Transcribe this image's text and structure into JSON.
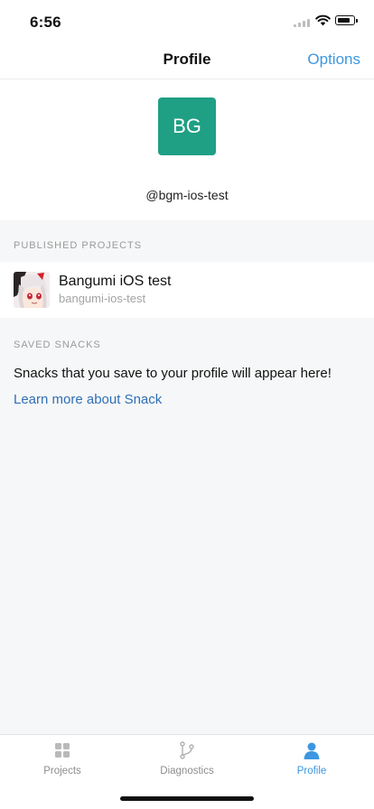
{
  "status_bar": {
    "time": "6:56"
  },
  "nav": {
    "title": "Profile",
    "options_label": "Options"
  },
  "profile": {
    "initials": "BG",
    "avatar_color": "#1f9f84",
    "username": "@bgm-ios-test"
  },
  "published": {
    "header": "PUBLISHED PROJECTS",
    "projects": [
      {
        "name": "Bangumi iOS test",
        "slug": "bangumi-ios-test"
      }
    ]
  },
  "saved": {
    "header": "SAVED SNACKS",
    "empty_message": "Snacks that you save to your profile will appear here!",
    "learn_more": "Learn more about Snack"
  },
  "tabs": [
    {
      "label": "Projects",
      "icon": "grid-icon",
      "active": false
    },
    {
      "label": "Diagnostics",
      "icon": "branch-icon",
      "active": false
    },
    {
      "label": "Profile",
      "icon": "person-icon",
      "active": true
    }
  ],
  "colors": {
    "accent": "#3c97e0",
    "link": "#2f6fb6",
    "background": "#f6f7f8"
  }
}
